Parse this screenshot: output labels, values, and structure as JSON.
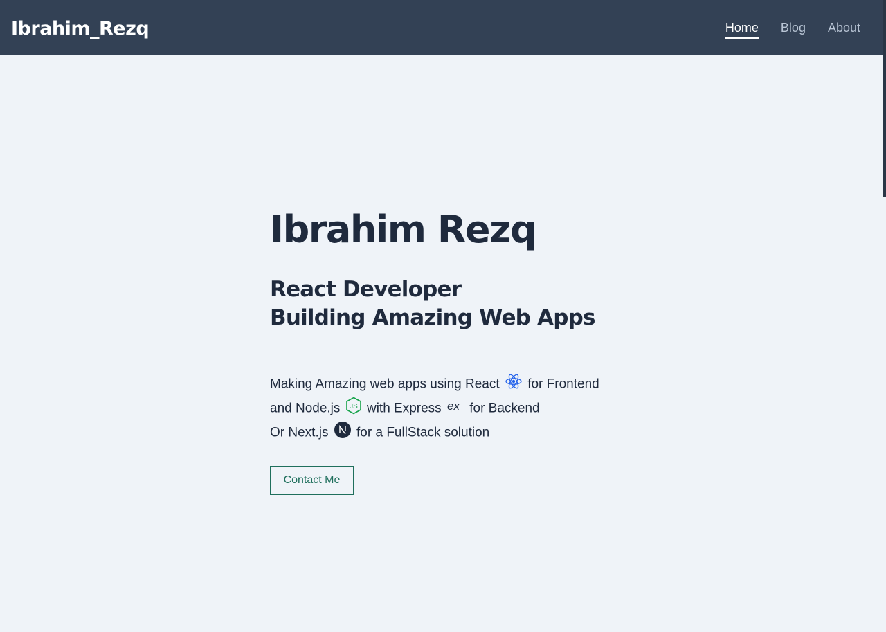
{
  "navbar": {
    "brand": "Ibrahim_Rezq",
    "links": [
      {
        "label": "Home",
        "active": true
      },
      {
        "label": "Blog",
        "active": false
      },
      {
        "label": "About",
        "active": false
      }
    ]
  },
  "hero": {
    "name": "Ibrahim Rezq",
    "tagline_line1": "React Developer",
    "tagline_line2": "Building Amazing Web Apps",
    "desc": {
      "l1_a": "Making Amazing web apps using React",
      "l1_b": "for Frontend",
      "l2_a": "and Node.js",
      "l2_b": "with Express",
      "l2_c": "for Backend",
      "l3_a": "Or Next.js",
      "l3_b": "for a FullStack solution"
    },
    "icons": {
      "react": "react-icon",
      "node": "nodejs-icon",
      "express": "express-icon",
      "next": "nextjs-icon"
    },
    "contact_label": "Contact Me"
  },
  "colors": {
    "navbar_bg": "#334155",
    "page_bg": "#eff3f8",
    "text": "#1f2a3d",
    "button_accent": "#1f6f5c",
    "react": "#2563eb",
    "node": "#16a34a"
  }
}
